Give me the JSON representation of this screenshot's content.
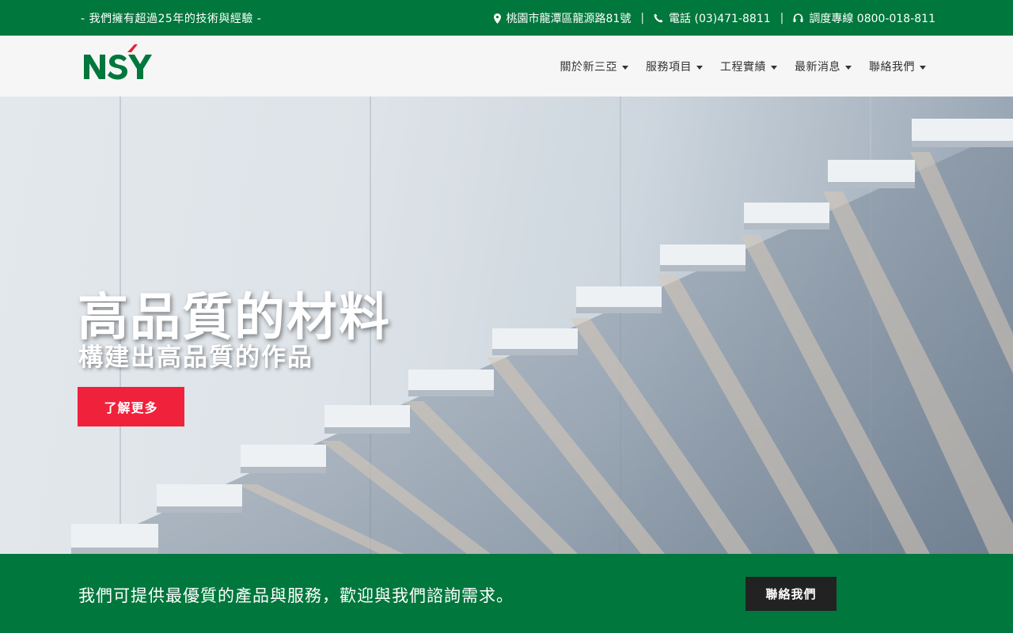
{
  "topbar": {
    "tagline": "- 我們擁有超過25年的技術與經驗 -",
    "address": "桃園市龍潭區龍源路81號",
    "phone": "電話 (03)471-8811",
    "hotline": "調度專線 0800-018-811",
    "separator": "|"
  },
  "logo": {
    "text": "NSY",
    "brand_color": "#00773c",
    "accent_color": "#e8202f"
  },
  "nav": {
    "items": [
      {
        "label": "關於新三亞"
      },
      {
        "label": "服務項目"
      },
      {
        "label": "工程實績"
      },
      {
        "label": "最新消息"
      },
      {
        "label": "聯絡我們"
      }
    ]
  },
  "hero": {
    "title": "高品質的材料",
    "subtitle": "構建出高品質的作品",
    "button_label": "了解更多"
  },
  "cta": {
    "text": "我們可提供最優質的產品與服務，歡迎與我們諮詢需求。",
    "button_label": "聯絡我們"
  },
  "colors": {
    "primary_green": "#00773c",
    "accent_red": "#f0213b",
    "dark_button": "#222222"
  },
  "icons": [
    "map-pin-icon",
    "phone-icon",
    "headset-icon",
    "chevron-down-icon"
  ]
}
